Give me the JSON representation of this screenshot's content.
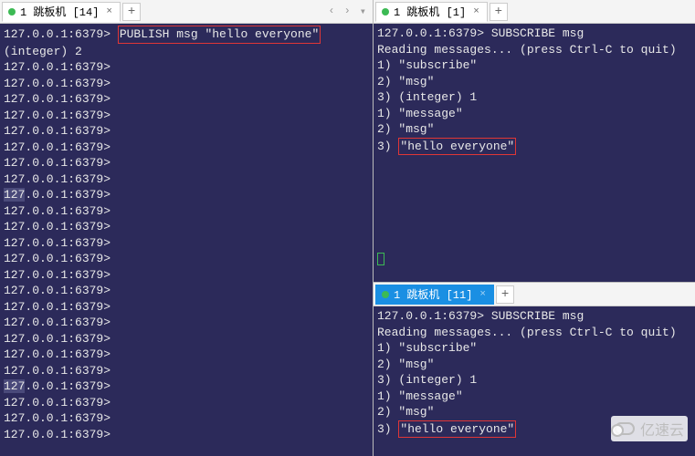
{
  "left": {
    "tab_label": "1 跳板机 [14]",
    "add": "+",
    "nav": {
      "prev": "‹",
      "next": "›",
      "menu": "▾"
    },
    "prompt": "127.0.0.1:6379>",
    "cmd_highlight": "PUBLISH msg \"hello everyone\"",
    "result": "(integer) 2",
    "empty_prompt_count": 24
  },
  "rtop": {
    "tab_label": "1 跳板机 [1]",
    "add": "+",
    "prompt": "127.0.0.1:6379>",
    "cmd": " SUBSCRIBE msg",
    "reading": "Reading messages... (press Ctrl-C to quit)",
    "lines": [
      "1) \"subscribe\"",
      "2) \"msg\"",
      "3) (integer) 1",
      "1) \"message\"",
      "2) \"msg\""
    ],
    "hl_prefix": "3) ",
    "hl_text": "\"hello everyone\""
  },
  "rbot": {
    "tab_label": "1 跳板机 [11]",
    "add": "+",
    "prompt": "127.0.0.1:6379>",
    "cmd": " SUBSCRIBE msg",
    "reading": "Reading messages... (press Ctrl-C to quit)",
    "lines": [
      "1) \"subscribe\"",
      "2) \"msg\"",
      "3) (integer) 1",
      "1) \"message\"",
      "2) \"msg\""
    ],
    "hl_prefix": "3) ",
    "hl_text": "\"hello everyone\""
  },
  "watermark": "亿速云"
}
